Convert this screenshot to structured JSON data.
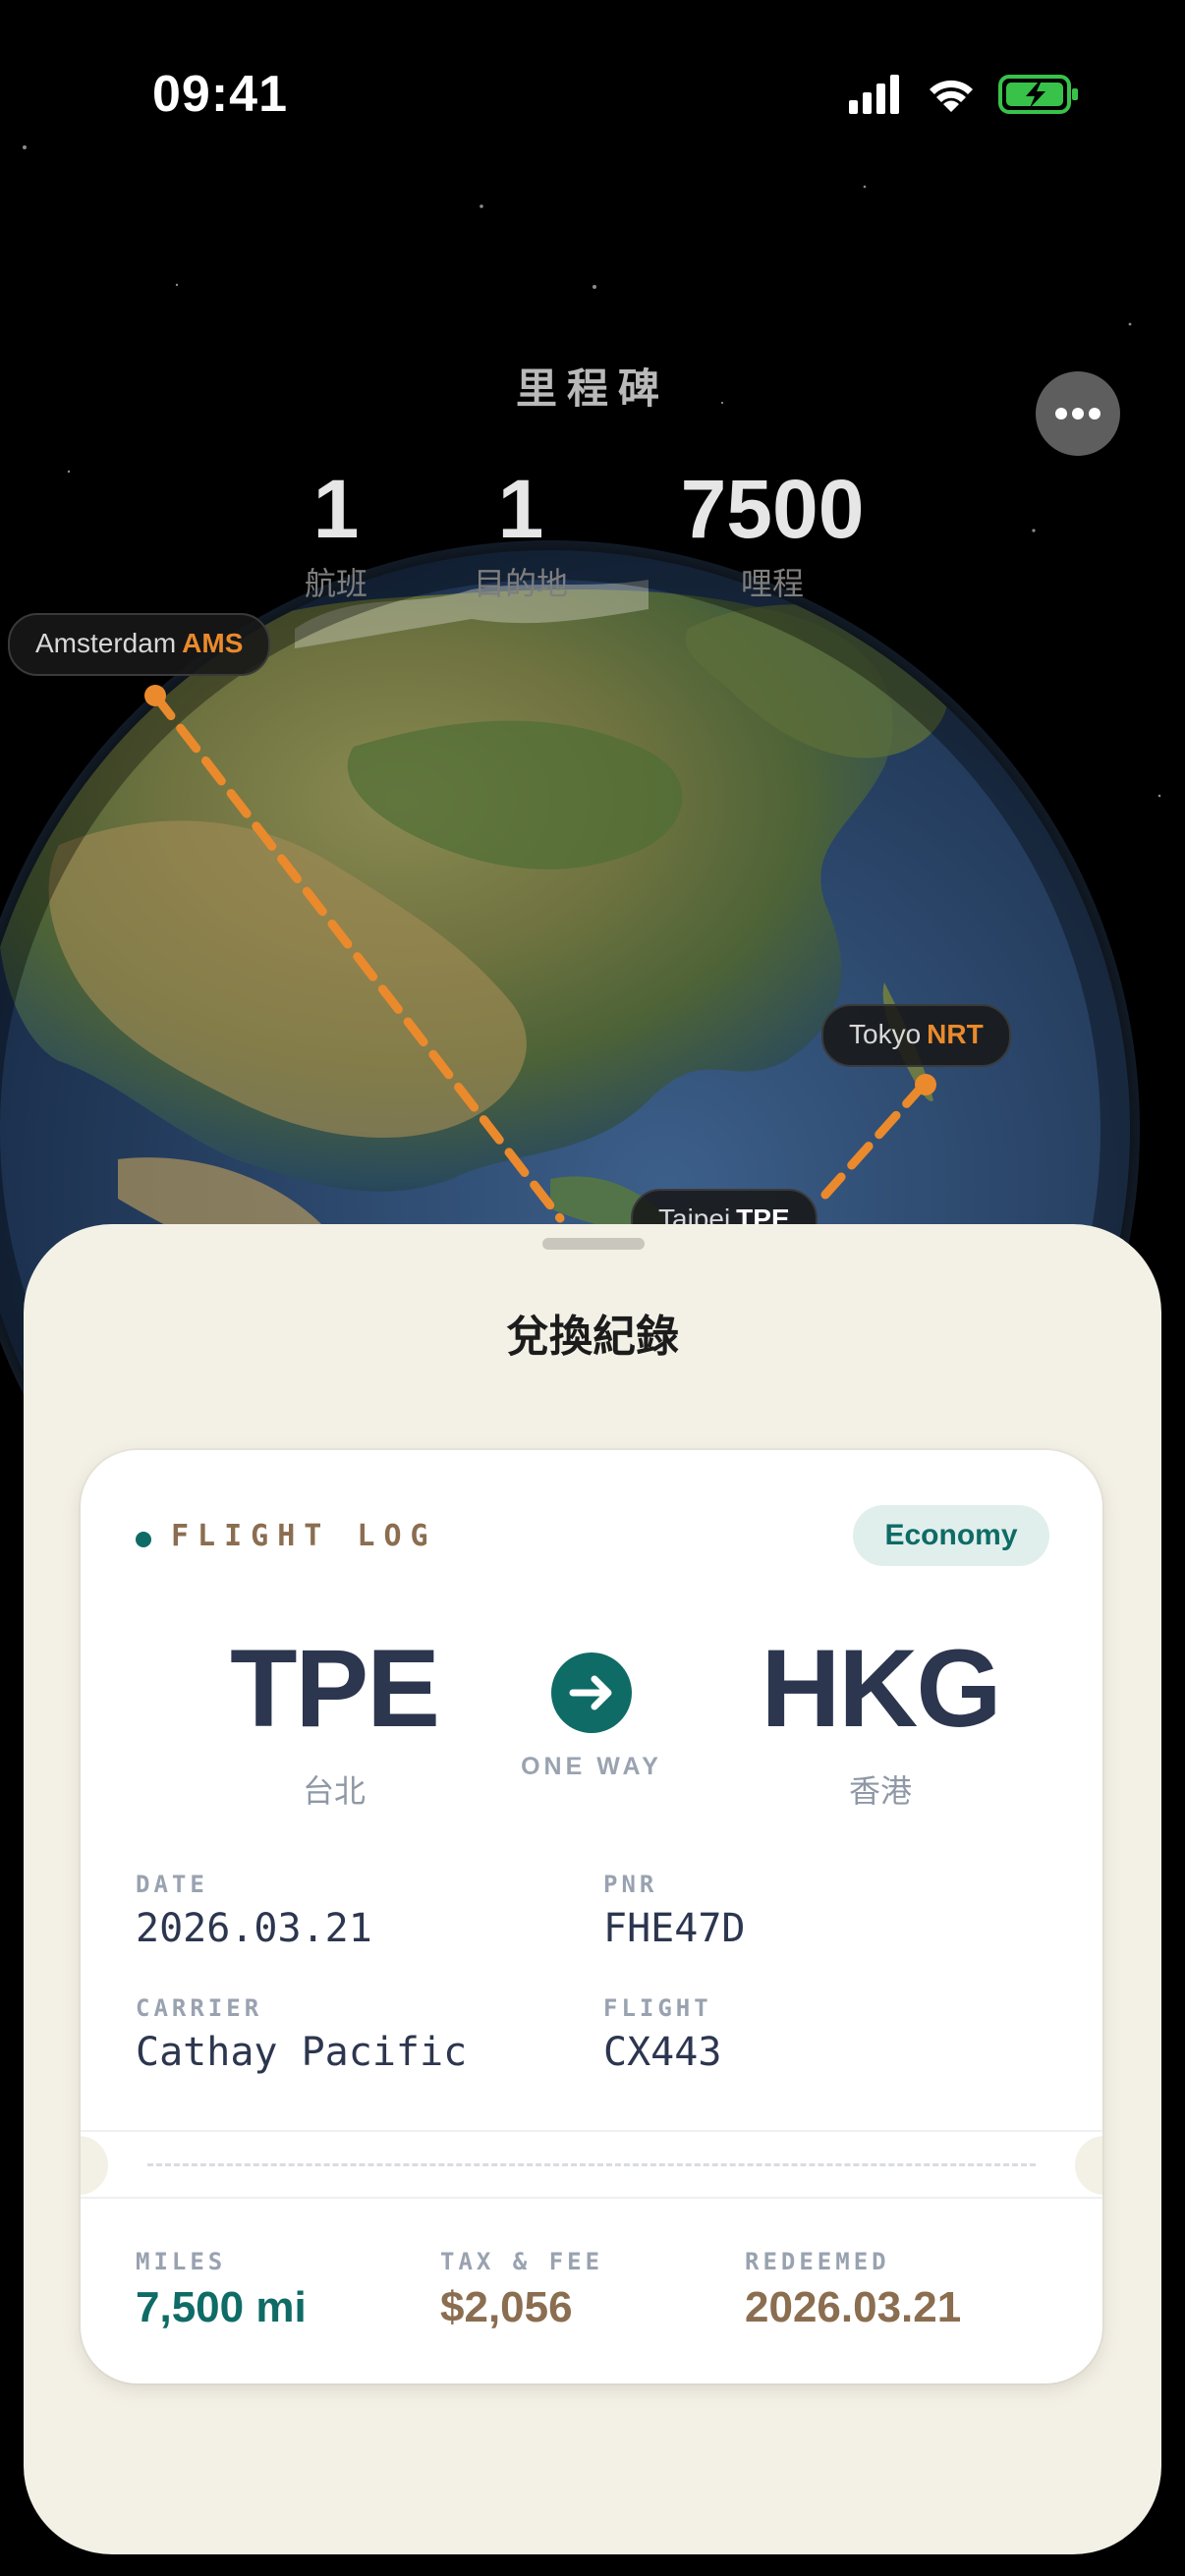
{
  "status_bar": {
    "time": "09:41"
  },
  "header": {
    "title": "里程碑",
    "more_icon": "ellipsis-icon"
  },
  "stats": [
    {
      "value": "1",
      "label": "航班"
    },
    {
      "value": "1",
      "label": "目的地"
    },
    {
      "value": "7500",
      "label": "哩程"
    }
  ],
  "map": {
    "cities": [
      {
        "name": "Amsterdam",
        "code": "AMS"
      },
      {
        "name": "Tokyo",
        "code": "NRT"
      },
      {
        "name": "Taipei",
        "code": "TPE"
      }
    ],
    "route_color": "#ea8a2c"
  },
  "sheet": {
    "title": "兌換紀錄",
    "card": {
      "section_title": "FLIGHT LOG",
      "cabin_class": "Economy",
      "origin": {
        "code": "TPE",
        "city": "台北"
      },
      "destination": {
        "code": "HKG",
        "city": "香港"
      },
      "trip_type": "ONE WAY",
      "arrow_icon": "arrow-right-icon",
      "fields": {
        "date_label": "DATE",
        "date_value": "2026.03.21",
        "pnr_label": "PNR",
        "pnr_value": "FHE47D",
        "carrier_label": "CARRIER",
        "carrier_value": "Cathay Pacific",
        "flight_label": "FLIGHT",
        "flight_value": "CX443"
      },
      "footer": {
        "miles_label": "MILES",
        "miles_value": "7,500 mi",
        "tax_label": "TAX & FEE",
        "tax_value": "$2,056",
        "redeemed_label": "REDEEMED",
        "redeemed_value": "2026.03.21"
      }
    }
  },
  "colors": {
    "accent_teal": "#0f6b66",
    "accent_brown": "#8b6d50",
    "route_orange": "#ea8a2c",
    "sheet_bg": "#f3f0e6"
  }
}
